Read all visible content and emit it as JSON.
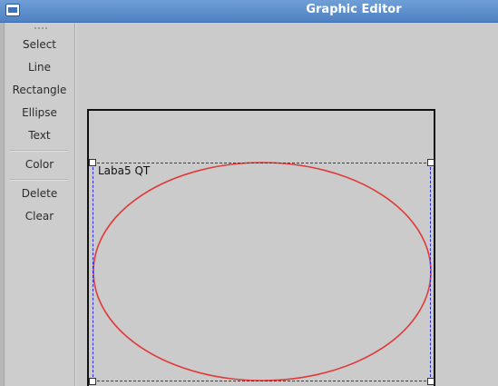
{
  "window": {
    "title": "Graphic Editor",
    "icon": "app-window-icon"
  },
  "toolbar": {
    "tools": [
      {
        "label": "Select"
      },
      {
        "label": "Line"
      },
      {
        "label": "Rectangle"
      },
      {
        "label": "Ellipse"
      },
      {
        "label": "Text"
      },
      {
        "label": "Color"
      },
      {
        "label": "Delete"
      },
      {
        "label": "Clear"
      }
    ]
  },
  "canvas": {
    "text_item": "Laba5 QT",
    "colors": {
      "ellipse_stroke": "#e03a3a",
      "selection_dash": "#2a2ae0",
      "rectangle_stroke": "#111111",
      "background": "#cbcbcb"
    }
  }
}
